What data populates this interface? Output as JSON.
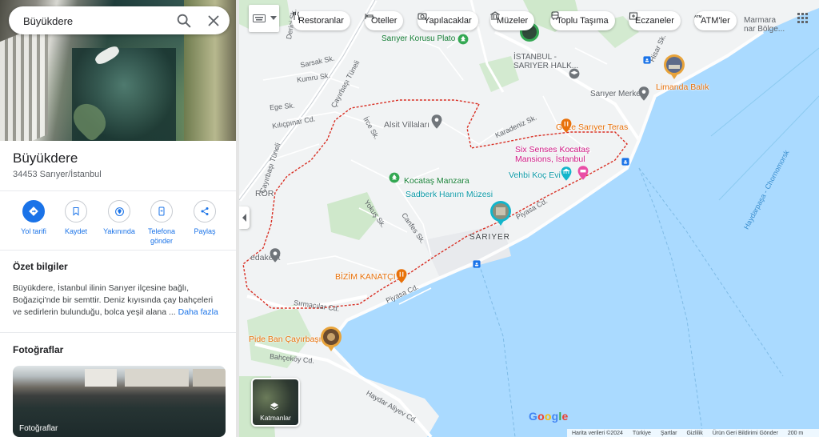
{
  "search": {
    "value": "Büyükdere"
  },
  "place": {
    "title": "Büyükdere",
    "address": "34453 Sarıyer/İstanbul"
  },
  "actions": [
    {
      "label": "Yol tarifi"
    },
    {
      "label": "Kaydet"
    },
    {
      "label": "Yakınında"
    },
    {
      "label": "Telefona gönder"
    },
    {
      "label": "Paylaş"
    }
  ],
  "summary": {
    "title": "Özet bilgiler",
    "text": "Büyükdere, İstanbul ilinin Sarıyer ilçesine bağlı, Boğaziçi'nde bir semttir. Deniz kıyısında çay bahçeleri ve sedirlerin bulunduğu, bolca yeşil alana ...",
    "more": "Daha fazla"
  },
  "photos": {
    "title": "Fotoğraflar",
    "caption": "Fotoğraflar"
  },
  "chips": [
    {
      "label": "Restoranlar",
      "icon": "fork-knife-icon"
    },
    {
      "label": "Oteller",
      "icon": "bed-icon"
    },
    {
      "label": "Yapılacaklar",
      "icon": "camera-icon"
    },
    {
      "label": "Müzeler",
      "icon": "museum-icon"
    },
    {
      "label": "Toplu Taşıma",
      "icon": "transit-icon"
    },
    {
      "label": "Eczaneler",
      "icon": "pharmacy-icon"
    },
    {
      "label": "ATM'ler",
      "icon": "atm-icon"
    }
  ],
  "map_labels": {
    "sariyer_korusu": "Sarıyer Korusu Plato",
    "istanbul_sariyer": "İSTANBUL -",
    "sariyer_halk": "SARIYER HALK...",
    "marmara": "Marmara",
    "marmara2": "nar Bölge...",
    "limanda": "Limanda Balık",
    "sariyer_merkez": "Sarıyer Merkez",
    "goze": "Göze Sarıyer Teras",
    "six_senses": "Six Senses Kocataş",
    "six_senses2": "Mansions, İstanbul",
    "vehbi": "Vehbi Koç Evi",
    "alsit": "Alsit Villaları",
    "kocatas": "Kocataş Manzara",
    "sadberk": "Sadberk Hanım Müzesi",
    "sariyer": "SARIYER",
    "bizim": "BİZİM KANATÇI",
    "pide": "Pide Ban Çayırbaşı",
    "sedakent": "edakent",
    "ror": "ROR",
    "cayirbasi_tuneli": "Çayırbaşı Tüneli",
    "cayirbasi_tuneli2": "Çayırbaşı Tüneli",
    "kilicpinar": "Kılıçpınar Cd.",
    "piyasa1": "Piyasa Cd.",
    "piyasa2": "Piyasa Cd.",
    "sirmacilar": "Sırmacılar Cd.",
    "bahcekoy": "Bahçeköy Cd.",
    "haydar": "Haydar Aliyev Cd.",
    "yokus": "Yokuş Sk.",
    "canfes": "Canfes Sk.",
    "karadeniz": "Karadeniz Sk.",
    "ege": "Ege Sk.",
    "irce": "İrce Sk.",
    "kumru": "Kumru Sk.",
    "sarsak": "Sarsak Sk.",
    "hisar": "Hisar Sk.",
    "haydarpasa": "Haydarpaşa - Chornomorsk",
    "derici": "Derici Sk."
  },
  "layers": {
    "label": "Katmanlar"
  },
  "google": "Google",
  "footer": {
    "data": "Harita verileri ©2024",
    "country": "Türkiye",
    "terms": "Şartlar",
    "privacy": "Gizlilik",
    "feedback": "Ürün Geri Bildirimi Gönder",
    "scale": "200 m"
  },
  "colors": {
    "water": "#aadaff",
    "land": "#f1f3f4",
    "park": "#c8e6c4",
    "road": "#ffffff",
    "boundary": "#d93025",
    "accent": "#1a73e8",
    "food": "#e8710a",
    "attraction": "#12b5cb"
  }
}
